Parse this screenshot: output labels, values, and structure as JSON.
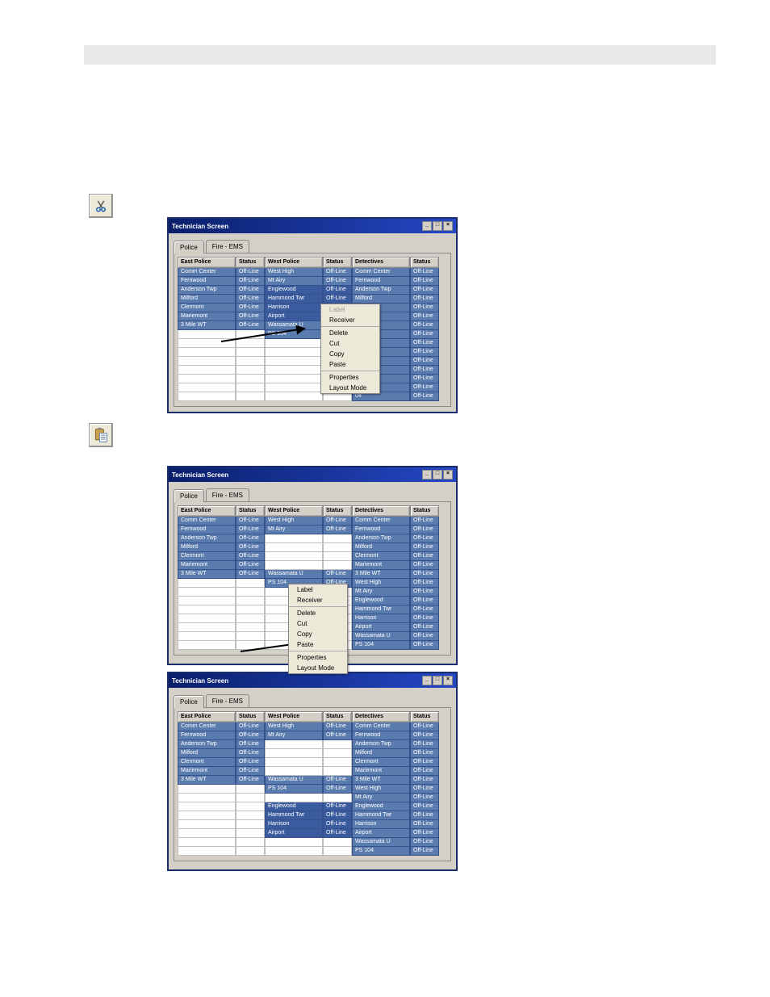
{
  "window_title": "Technician Screen",
  "tabs": [
    "Police",
    "Fire - EMS"
  ],
  "ctx_menu": {
    "label": "Label",
    "receiver": "Receiver",
    "delete": "Delete",
    "cut": "Cut",
    "copy": "Copy",
    "paste": "Paste",
    "properties": "Properties",
    "layout": "Layout Mode"
  },
  "offline": "Off-Line",
  "cols": {
    "c1h": "East Police",
    "s1h": "Status",
    "c2h": "West Police",
    "s2h": "Status",
    "c3h": "Detectives",
    "s3h": "Status"
  },
  "fig1": {
    "c1": [
      "Comm Center",
      "Fernwood",
      "Anderson Twp",
      "Milford",
      "Clermont",
      "Mariemont",
      "3 Mile WT",
      "",
      "",
      "",
      "",
      "",
      "",
      ""
    ],
    "c2": [
      "West High",
      "Mt Airy",
      "Englewood",
      "Hammond Twr",
      "Harrison",
      "Airport",
      "Wassamata U",
      "PS 104",
      "",
      "",
      "",
      "",
      "",
      ""
    ],
    "c3": [
      "Comm Center",
      "Fernwood",
      "Anderson Twp",
      "Milford",
      "Clermont",
      "emont",
      "e WT",
      "High",
      "ry",
      "ewood",
      "mond Twr",
      "son",
      "rt",
      "samata U",
      "04"
    ]
  },
  "fig2": {
    "c1": [
      "Comm Center",
      "Fernwood",
      "Anderson Twp",
      "Milford",
      "Clermont",
      "Mariemont",
      "3 Mile WT",
      "",
      "",
      "",
      "",
      "",
      "",
      ""
    ],
    "c2": [
      "West High",
      "Mt Airy",
      "",
      "",
      "",
      "",
      "Wassamata U",
      "PS 104",
      "",
      "",
      "",
      "",
      "",
      ""
    ],
    "c3": [
      "Comm Center",
      "Fernwood",
      "Anderson Twp",
      "Milford",
      "Clermont",
      "Mariemont",
      "3 Mile WT",
      "West High",
      "Mt Airy",
      "Englewood",
      "Hammond Twr",
      "Harrison",
      "Airport",
      "Wassamata U",
      "PS 104"
    ]
  },
  "fig3": {
    "c1": [
      "Comm Center",
      "Fernwood",
      "Anderson Twp",
      "Milford",
      "Clermont",
      "Mariemont",
      "3 Mile WT",
      "",
      "",
      "",
      "",
      "",
      "",
      ""
    ],
    "c2": [
      "West High",
      "Mt Airy",
      "",
      "",
      "",
      "",
      "Wassamata U",
      "PS 104",
      "",
      "Englewood",
      "Hammond Twr",
      "Harrison",
      "Airport",
      ""
    ],
    "c3": [
      "Comm Center",
      "Fernwood",
      "Anderson Twp",
      "Milford",
      "Clermont",
      "Mariemont",
      "3 Mile WT",
      "West High",
      "Mt Airy",
      "Englewood",
      "Hammond Twr",
      "Harrison",
      "Airport",
      "Wassamata U",
      "PS 104"
    ]
  },
  "widths": {
    "name": 72,
    "status": 36,
    "name2": 72,
    "status2": 36,
    "name3": 72,
    "status3": 36
  }
}
